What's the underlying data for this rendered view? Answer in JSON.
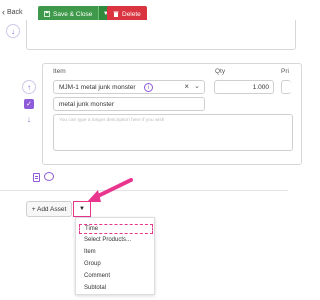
{
  "toolbar": {
    "back_label": "Back",
    "save_label": "Save & Close",
    "delete_label": "Delete"
  },
  "item_row": {
    "item_header": "Item",
    "qty_header": "Qty",
    "price_header": "Pri",
    "item_value": "MJM-1 metal junk monster",
    "qty_value": "1.000",
    "name_value": "metal junk monster",
    "description_placeholder": "You can type a longer description here if you wish"
  },
  "add_asset": {
    "label": "+ Add Asset"
  },
  "menu": {
    "items": [
      "Time",
      "Select Products...",
      "Item",
      "Group",
      "Comment",
      "Subtotal"
    ]
  },
  "colors": {
    "save": "#3e9a4a",
    "delete": "#d9343f",
    "accent": "#8e5cd9",
    "highlight": "#e8358e"
  }
}
